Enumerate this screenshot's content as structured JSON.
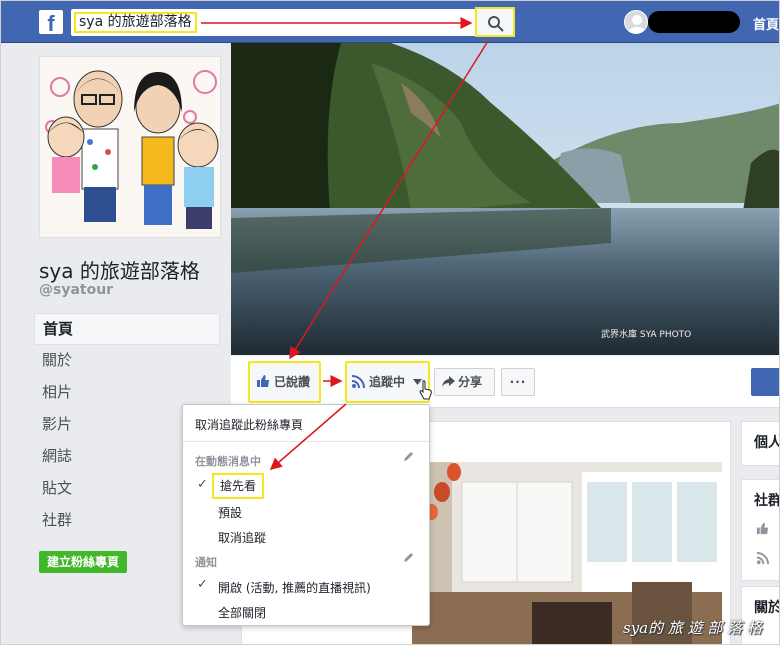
{
  "topbar": {
    "logo": "f",
    "search_value": "sya 的旅遊部落格",
    "home_label": "首頁"
  },
  "profile": {
    "name": "sya 的旅遊部落格",
    "handle": "@syatour"
  },
  "sidebar": {
    "items": [
      {
        "label": "首頁"
      },
      {
        "label": "關於"
      },
      {
        "label": "相片"
      },
      {
        "label": "影片"
      },
      {
        "label": "網誌"
      },
      {
        "label": "貼文"
      },
      {
        "label": "社群"
      }
    ],
    "create_page_label": "建立粉絲專頁"
  },
  "cover": {
    "watermark": "武界水庫    SYA PHOTO"
  },
  "actions": {
    "liked_label": "已說讚",
    "following_label": "追蹤中",
    "share_label": "分享",
    "more_label": "···"
  },
  "dropdown": {
    "unfollow_page": "取消追蹤此粉絲專頁",
    "in_feed_header": "在動態消息中",
    "see_first": "搶先看",
    "default": "預設",
    "unfollow": "取消追蹤",
    "notifications_header": "通知",
    "on_option": "開啟 (活動, 推薦的直播視訊)",
    "all_off": "全部關閉"
  },
  "right_rail": {
    "card1": "個人",
    "card2": "社群",
    "card3": "關於"
  },
  "signature": "sya的 旅 遊 部 落 格",
  "colors": {
    "fb_blue": "#4267b2",
    "highlight": "#f5e61d",
    "arrow": "#e0161d",
    "green": "#42b72a"
  }
}
